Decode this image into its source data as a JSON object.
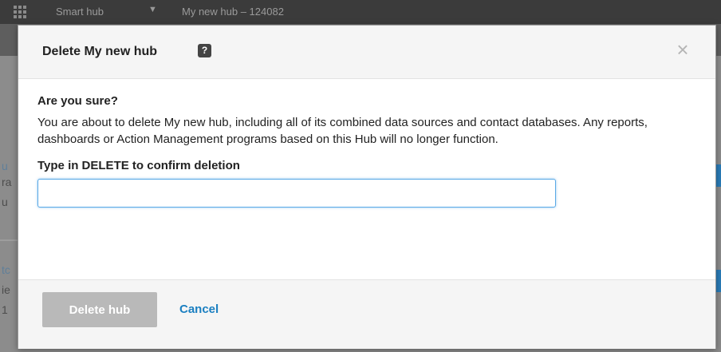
{
  "app": {
    "menu_icon": "grid-icon",
    "breadcrumb": [
      "Smart hub",
      "My new hub – 124082"
    ]
  },
  "background": {
    "letters": [
      {
        "text": "u",
        "style": "link"
      },
      {
        "text": "ra",
        "style": "grey"
      },
      {
        "text": "u",
        "style": "grey"
      },
      {
        "text": "tc",
        "style": "link"
      },
      {
        "text": "ie",
        "style": "grey"
      },
      {
        "text": "1",
        "style": "grey"
      }
    ]
  },
  "dialog": {
    "title": "Delete My new hub",
    "help_icon": "question-icon",
    "close_icon": "close-icon",
    "close_glyph": "×",
    "heading": "Are you sure?",
    "warning": "You are about to delete My new hub, including all of its combined data sources and contact databases. Any reports, dashboards or Action Management programs based on this Hub will no longer function.",
    "confirm_label": "Type in DELETE to confirm deletion",
    "confirm_value": "",
    "confirm_placeholder": "",
    "delete_label": "Delete hub",
    "delete_enabled": false,
    "cancel_label": "Cancel"
  },
  "colors": {
    "accent": "#1a7fc1",
    "disabled_button": "#b9b9b9",
    "overlay": "#7a7a7a"
  }
}
